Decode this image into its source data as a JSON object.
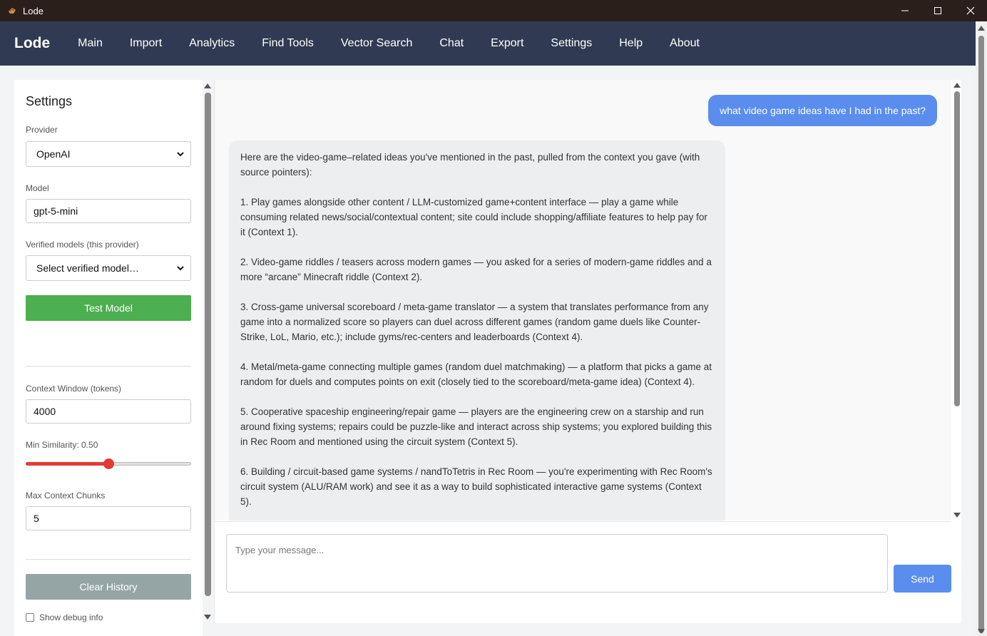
{
  "window": {
    "title": "Lode"
  },
  "navbar": {
    "brand": "Lode",
    "items": [
      {
        "label": "Main"
      },
      {
        "label": "Import"
      },
      {
        "label": "Analytics"
      },
      {
        "label": "Find Tools"
      },
      {
        "label": "Vector Search"
      },
      {
        "label": "Chat"
      },
      {
        "label": "Export"
      },
      {
        "label": "Settings"
      },
      {
        "label": "Help"
      },
      {
        "label": "About"
      }
    ]
  },
  "sidebar": {
    "title": "Settings",
    "provider_label": "Provider",
    "provider_value": "OpenAI",
    "model_label": "Model",
    "model_value": "gpt-5-mini",
    "verified_label": "Verified models (this provider)",
    "verified_value": "Select verified model…",
    "test_button": "Test Model",
    "context_label": "Context Window (tokens)",
    "context_value": "4000",
    "similarity_label": "Min Similarity: 0.50",
    "similarity_value": 0.5,
    "chunks_label": "Max Context Chunks",
    "chunks_value": "5",
    "clear_button": "Clear History",
    "debug_label": "Show debug info"
  },
  "chat": {
    "user_message": "what video game ideas have I had in the past?",
    "bot_paragraphs": [
      "Here are the video-game–related ideas you've mentioned in the past, pulled from the context you gave (with source pointers):",
      "1. Play games alongside other content / LLM-customized game+content interface — play a game while consuming related news/social/contextual content; site could include shopping/affiliate features to help pay for it (Context 1).",
      "2. Video-game riddles / teasers across modern games — you asked for a series of modern-game riddles and a more “arcane” Minecraft riddle (Context 2).",
      "3. Cross-game universal scoreboard / meta-game translator — a system that translates performance from any game into a normalized score so players can duel across different games (random game duels like Counter-Strike, LoL, Mario, etc.); include gyms/rec-centers and leaderboards (Context 4).",
      "4. Metal/meta-game connecting multiple games (random duel matchmaking) — a platform that picks a game at random for duels and computes points on exit (closely tied to the scoreboard/meta-game idea) (Context 4).",
      "5. Cooperative spaceship engineering/repair game — players are the engineering crew on a starship and run around fixing systems; repairs could be puzzle-like and interact across ship systems; you explored building this in Rec Room and mentioned using the circuit system (Context 5).",
      "6. Building / circuit-based game systems / nandToTetris in Rec Room — you're experimenting with Rec Room's circuit system (ALU/RAM work) and see it as a way to build sophisticated interactive game systems (Context 5)."
    ],
    "input_placeholder": "Type your message...",
    "send_button": "Send"
  },
  "colors": {
    "navbar": "#303a52",
    "titlebar": "#2b1f1c",
    "accent_blue": "#5b8def",
    "green": "#4caf50",
    "slider_red": "#e53935"
  }
}
